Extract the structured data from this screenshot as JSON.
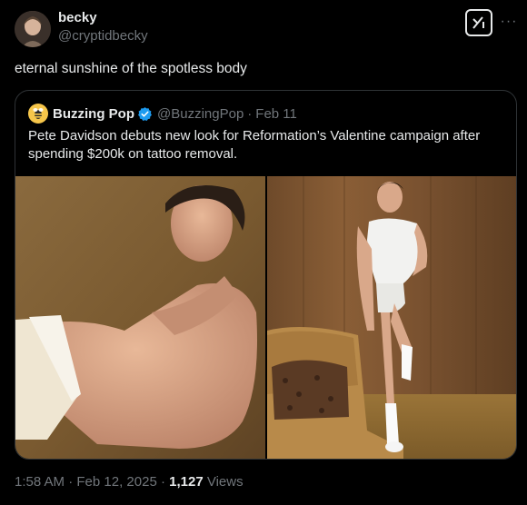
{
  "tweet": {
    "display_name": "becky",
    "handle": "@cryptidbecky",
    "text": "eternal sunshine of the spotless body",
    "time": "1:58 AM",
    "separator": "·",
    "date": "Feb 12, 2025",
    "views_count": "1,127",
    "views_label": "Views"
  },
  "quoted": {
    "display_name": "Buzzing Pop",
    "handle": "@BuzzingPop",
    "separator": "·",
    "date": "Feb 11",
    "text": "Pete Davidson debuts new look for Reformation’s Valentine campaign after spending $200k on tattoo removal."
  },
  "icons": {
    "grok": "grok-icon",
    "more": "more-icon",
    "verified": "verified-badge-icon"
  },
  "colors": {
    "background": "#000000",
    "text": "#e7e9ea",
    "muted": "#71767b",
    "border": "#2f3336",
    "verified": "#1d9bf0"
  }
}
